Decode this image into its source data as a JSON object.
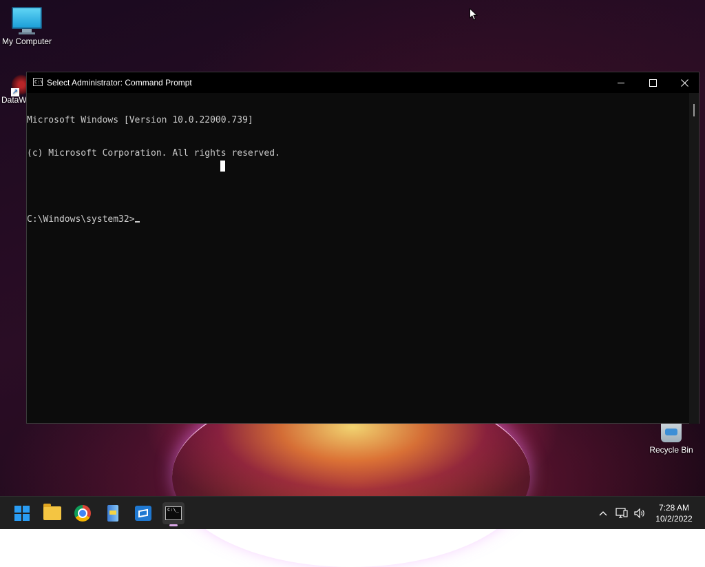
{
  "desktop": {
    "icons": [
      {
        "label": "My Computer",
        "icon": "computer-icon"
      },
      {
        "label": "DataW",
        "icon": "datawrapper-shortcut-icon"
      },
      {
        "label": "Recycle Bin",
        "icon": "recycle-bin-icon"
      }
    ]
  },
  "window": {
    "title": "Select Administrator: Command Prompt",
    "icon": "command-prompt-icon",
    "controls": [
      "minimize-icon",
      "maximize-icon",
      "close-icon"
    ],
    "console_lines": [
      "Microsoft Windows [Version 10.0.22000.739]",
      "(c) Microsoft Corporation. All rights reserved.",
      "",
      "C:\\Windows\\system32>"
    ]
  },
  "taskbar": {
    "apps": [
      "start-icon",
      "file-explorer-icon",
      "chrome-icon",
      "winrar-icon",
      "store-icon",
      "command-prompt-icon"
    ],
    "active_app": "command-prompt-icon",
    "indicator_color": "#d9a7e6",
    "tray": {
      "chevron": "^",
      "time": "7:28 AM",
      "date": "10/2/2022"
    }
  },
  "colors": {
    "console_bg": "#0c0c0c",
    "console_text": "#cccccc",
    "taskbar_bg": "#202020",
    "start_blue": "#2a9df4"
  }
}
